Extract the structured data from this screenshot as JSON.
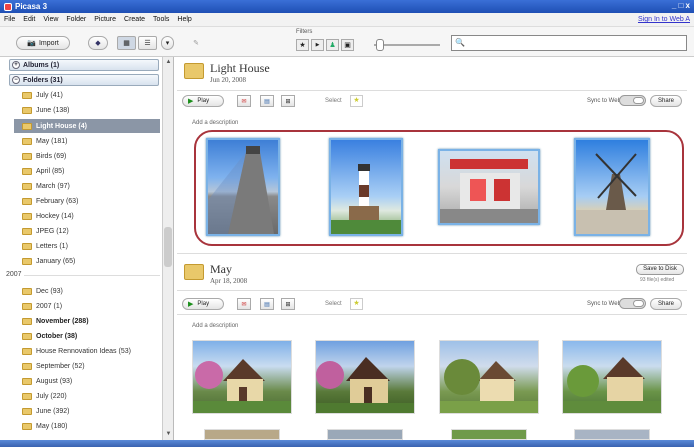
{
  "app": {
    "title": "Picasa 3",
    "window_controls": "_ □ x"
  },
  "menu": [
    "File",
    "Edit",
    "View",
    "Folder",
    "Picture",
    "Create",
    "Tools",
    "Help"
  ],
  "signin": "Sign In to Web A",
  "toolbar": {
    "import_label": "Import",
    "filters_label": "Filters"
  },
  "search": {
    "value": "",
    "placeholder": ""
  },
  "sidebar": {
    "albums": "Albums (1)",
    "folders": "Folders (31)",
    "folders_current": [
      {
        "label": "July (41)"
      },
      {
        "label": "June (138)"
      },
      {
        "label": "Light House (4)",
        "selected": true
      },
      {
        "label": "May (181)"
      },
      {
        "label": "Birds (69)"
      },
      {
        "label": "April (85)"
      },
      {
        "label": "March (97)"
      },
      {
        "label": "February (63)"
      },
      {
        "label": "Hockey (14)"
      },
      {
        "label": "JPEG (12)"
      },
      {
        "label": "Letters (1)"
      },
      {
        "label": "January (65)"
      }
    ],
    "year": "2007",
    "folders_2007": [
      {
        "label": "Dec (93)"
      },
      {
        "label": "2007 (1)"
      },
      {
        "label": "November (288)",
        "bold": true
      },
      {
        "label": "October (38)",
        "bold": true
      },
      {
        "label": "House Rennovation Ideas (53)"
      },
      {
        "label": "September (52)"
      },
      {
        "label": "August (93)"
      },
      {
        "label": "July (220)"
      },
      {
        "label": "June (392)"
      },
      {
        "label": "May (180)"
      }
    ]
  },
  "albums": [
    {
      "title": "Light House",
      "date": "Jun 20, 2008",
      "play": "Play",
      "select": "Select",
      "sync": "Sync to Web",
      "share": "Share",
      "description": "Add a description"
    },
    {
      "title": "May",
      "date": "Apr 18, 2008",
      "play": "Play",
      "select": "Select",
      "sync": "Sync to Web",
      "share": "Share",
      "description": "Add a description",
      "save_to_disk": "Save to Disk",
      "edited_note": "93 file(s) edited"
    }
  ],
  "colors": {
    "highlight_ring": "#a8343c",
    "selection": "#8b96a6",
    "thumb_border": "#7ab2e6"
  }
}
